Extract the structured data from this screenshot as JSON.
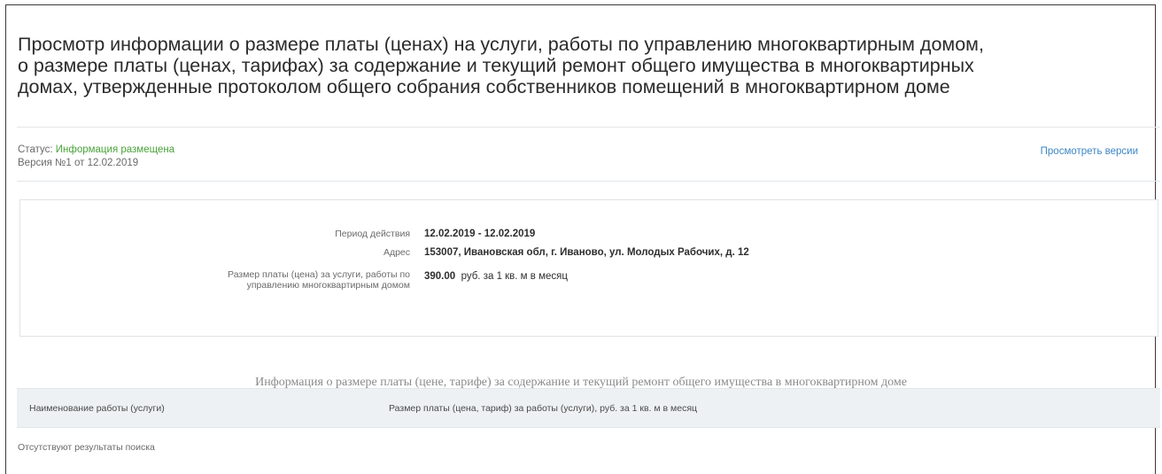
{
  "page": {
    "title_lines": [
      "Просмотр информации о размере платы (ценах) на услуги, работы по управлению многоквартирным домом,",
      "о размере платы (ценах, тарифах) за содержание и текущий ремонт общего имущества в многоквартирных",
      "домах, утвержденные протоколом общего собрания собственников помещений в многоквартирном доме"
    ]
  },
  "status": {
    "label": "Статус:",
    "value": "Информация размещена",
    "version": "Версия №1 от 12.02.2019",
    "versions_link": "Просмотреть версии"
  },
  "details": {
    "period": {
      "label": "Период действия",
      "value": "12.02.2019 - 12.02.2019"
    },
    "address": {
      "label": "Адрес",
      "value": "153007, Ивановская обл, г. Иваново, ул. Молодых Рабочих, д. 12"
    },
    "fee": {
      "label": "Размер платы (цена) за услуги, работы по управлению многоквартирным домом",
      "amount": "390.00",
      "unit": "руб. за 1 кв. м в месяц"
    }
  },
  "section": {
    "heading": "Информация о размере платы (цене, тарифе) за содержание и текущий ремонт общего имущества в многоквартирном доме"
  },
  "table": {
    "columns": [
      "Наименование работы (услуги)",
      "Размер платы (цена, тариф) за работы (услуги), руб. за 1 кв. м в месяц"
    ],
    "empty_text": "Отсутствуют результаты поиска"
  }
}
